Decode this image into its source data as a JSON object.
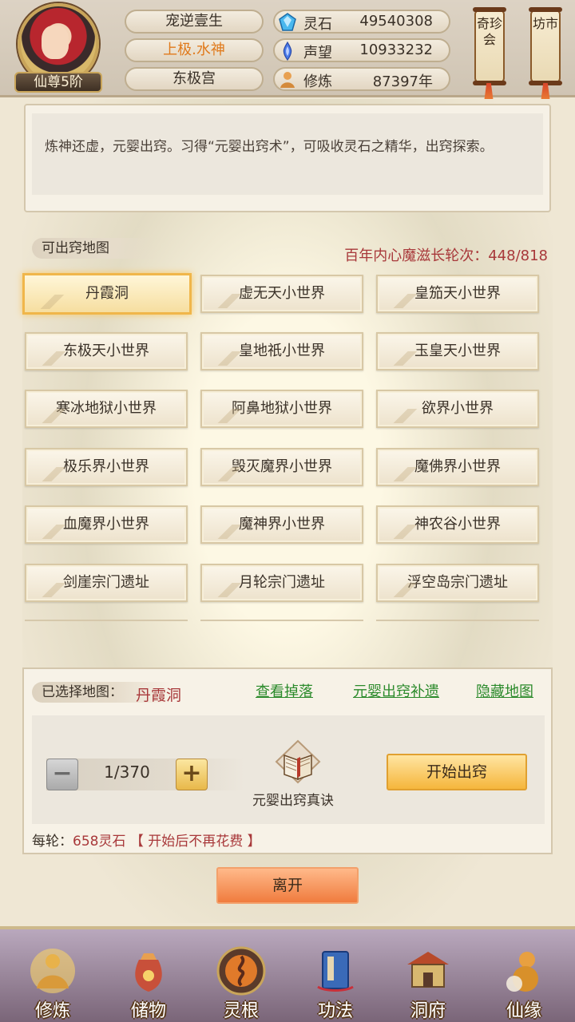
{
  "player": {
    "rank": "仙尊5阶",
    "name": "宠逆壹生",
    "title": "上极.水神",
    "palace": "东极宫"
  },
  "stats": [
    {
      "label": "灵石",
      "value": "49540308",
      "icon": "spirit-stone-icon",
      "color": "#3aa0e0"
    },
    {
      "label": "声望",
      "value": "10933232",
      "icon": "prestige-icon",
      "color": "#4a7ae8"
    },
    {
      "label": "修炼",
      "value": "87397年",
      "icon": "cultivation-icon",
      "color": "#d48a3a"
    }
  ],
  "top_buttons": {
    "treasure": "奇珍会",
    "market": "坊市"
  },
  "description": "炼神还虚，元婴出窍。习得“元婴出窍术”，可吸收灵石之精华，出窍探索。",
  "maps_section": {
    "label": "可出窍地图",
    "counter": "百年内心魔滋长轮次：448/818",
    "maps": [
      "丹霞洞",
      "虚无天小世界",
      "皇笳天小世界",
      "东极天小世界",
      "皇地祇小世界",
      "玉皇天小世界",
      "寒冰地狱小世界",
      "阿鼻地狱小世界",
      "欲界小世界",
      "极乐界小世界",
      "毁灭魔界小世界",
      "魔佛界小世界",
      "血魔界小世界",
      "魔神界小世界",
      "神农谷小世界",
      "剑崖宗门遗址",
      "月轮宗门遗址",
      "浮空岛宗门遗址"
    ],
    "selected_index": 0
  },
  "selection": {
    "label": "已选择地图：",
    "value": "丹霞洞",
    "links": [
      "查看掉落",
      "元婴出窍补遗",
      "隐藏地图"
    ]
  },
  "stepper": {
    "minus": "−",
    "value": "1/370",
    "plus": "+"
  },
  "item": {
    "label": "元婴出窍真诀",
    "icon": "book-icon"
  },
  "start_button": "开始出窍",
  "cost": {
    "prefix": "每轮：",
    "amount": "658灵石",
    "note": "【 开始后不再花费 】"
  },
  "leave_button": "离开",
  "nav": [
    {
      "label": "修炼",
      "icon": "meditation-icon",
      "color": "#d99a3a"
    },
    {
      "label": "储物",
      "icon": "storage-bag-icon",
      "color": "#c8503a"
    },
    {
      "label": "灵根",
      "icon": "spirit-root-icon",
      "color": "#e07a2a"
    },
    {
      "label": "功法",
      "icon": "scripture-book-icon",
      "color": "#3a6ab8"
    },
    {
      "label": "洞府",
      "icon": "cave-mansion-icon",
      "color": "#b88a3a"
    },
    {
      "label": "仙缘",
      "icon": "gourd-icon",
      "color": "#d89a3a"
    }
  ]
}
